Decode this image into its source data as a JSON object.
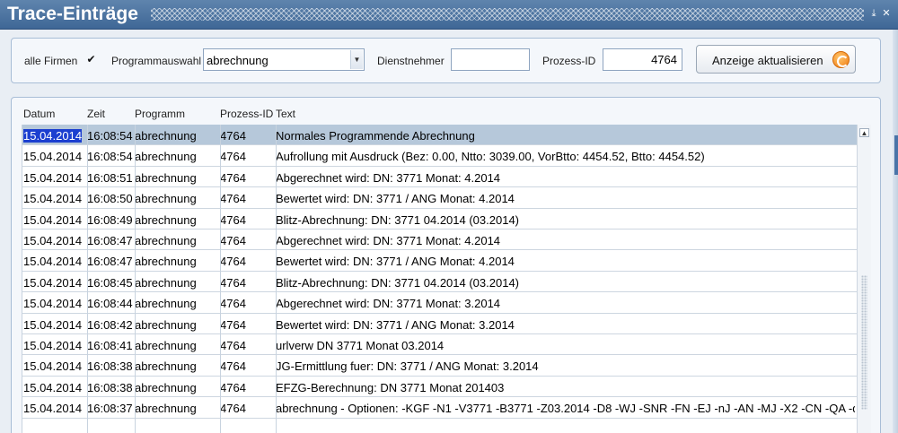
{
  "window": {
    "title": "Trace-Einträge"
  },
  "filter": {
    "all_companies_label": "alle Firmen",
    "all_companies_checked": true,
    "check_mark": "✔",
    "program_label": "Programmauswahl",
    "program_value": "abrechnung",
    "employee_label": "Dienstnehmer",
    "employee_value": "",
    "process_label": "Prozess-ID",
    "process_value": "4764",
    "refresh_label": "Anzeige aktualisieren"
  },
  "table": {
    "columns": [
      "Datum",
      "Zeit",
      "Programm",
      "Prozess-ID",
      "Text"
    ],
    "selected_row": 0,
    "rows": [
      [
        "15.04.2014",
        "16:08:54",
        "abrechnung",
        "4764",
        "Normales Programmende Abrechnung"
      ],
      [
        "15.04.2014",
        "16:08:54",
        "abrechnung",
        "4764",
        "Aufrollung mit Ausdruck (Bez: 0.00, Ntto: 3039.00, VorBtto: 4454.52, Btto: 4454.52)"
      ],
      [
        "15.04.2014",
        "16:08:51",
        "abrechnung",
        "4764",
        "Abgerechnet wird: DN: 3771 Monat: 4.2014"
      ],
      [
        "15.04.2014",
        "16:08:50",
        "abrechnung",
        "4764",
        "Bewertet wird: DN: 3771 / ANG Monat: 4.2014"
      ],
      [
        "15.04.2014",
        "16:08:49",
        "abrechnung",
        "4764",
        "Blitz-Abrechnung: DN: 3771 04.2014 (03.2014)"
      ],
      [
        "15.04.2014",
        "16:08:47",
        "abrechnung",
        "4764",
        "Abgerechnet wird: DN: 3771 Monat: 4.2014"
      ],
      [
        "15.04.2014",
        "16:08:47",
        "abrechnung",
        "4764",
        "Bewertet wird: DN: 3771 / ANG Monat: 4.2014"
      ],
      [
        "15.04.2014",
        "16:08:45",
        "abrechnung",
        "4764",
        "Blitz-Abrechnung: DN: 3771 04.2014 (03.2014)"
      ],
      [
        "15.04.2014",
        "16:08:44",
        "abrechnung",
        "4764",
        "Abgerechnet wird: DN: 3771 Monat: 3.2014"
      ],
      [
        "15.04.2014",
        "16:08:42",
        "abrechnung",
        "4764",
        "Bewertet wird: DN: 3771 / ANG Monat: 3.2014"
      ],
      [
        "15.04.2014",
        "16:08:41",
        "abrechnung",
        "4764",
        "urlverw DN 3771 Monat 03.2014"
      ],
      [
        "15.04.2014",
        "16:08:38",
        "abrechnung",
        "4764",
        "JG-Ermittlung fuer: DN: 3771 / ANG Monat: 3.2014"
      ],
      [
        "15.04.2014",
        "16:08:38",
        "abrechnung",
        "4764",
        "EFZG-Berechnung: DN 3771 Monat 201403"
      ],
      [
        "15.04.2014",
        "16:08:37",
        "abrechnung",
        "4764",
        "abrechnung - Optionen: -KGF -N1 -V3771 -B3771 -Z03.2014 -D8 -WJ -SNR -FN -EJ -nJ -AN -MJ -X2 -CN -QA -qN"
      ]
    ]
  },
  "colors": {
    "titlebar": "#4a72a0",
    "selection": "#1c3fd0",
    "selected_row": "#b6c8da",
    "refresh_icon": "#f07b12"
  },
  "icons": {
    "refresh": "refresh-icon",
    "dropdown": "chevron-down-icon",
    "scroll_up": "arrow-up-icon"
  }
}
